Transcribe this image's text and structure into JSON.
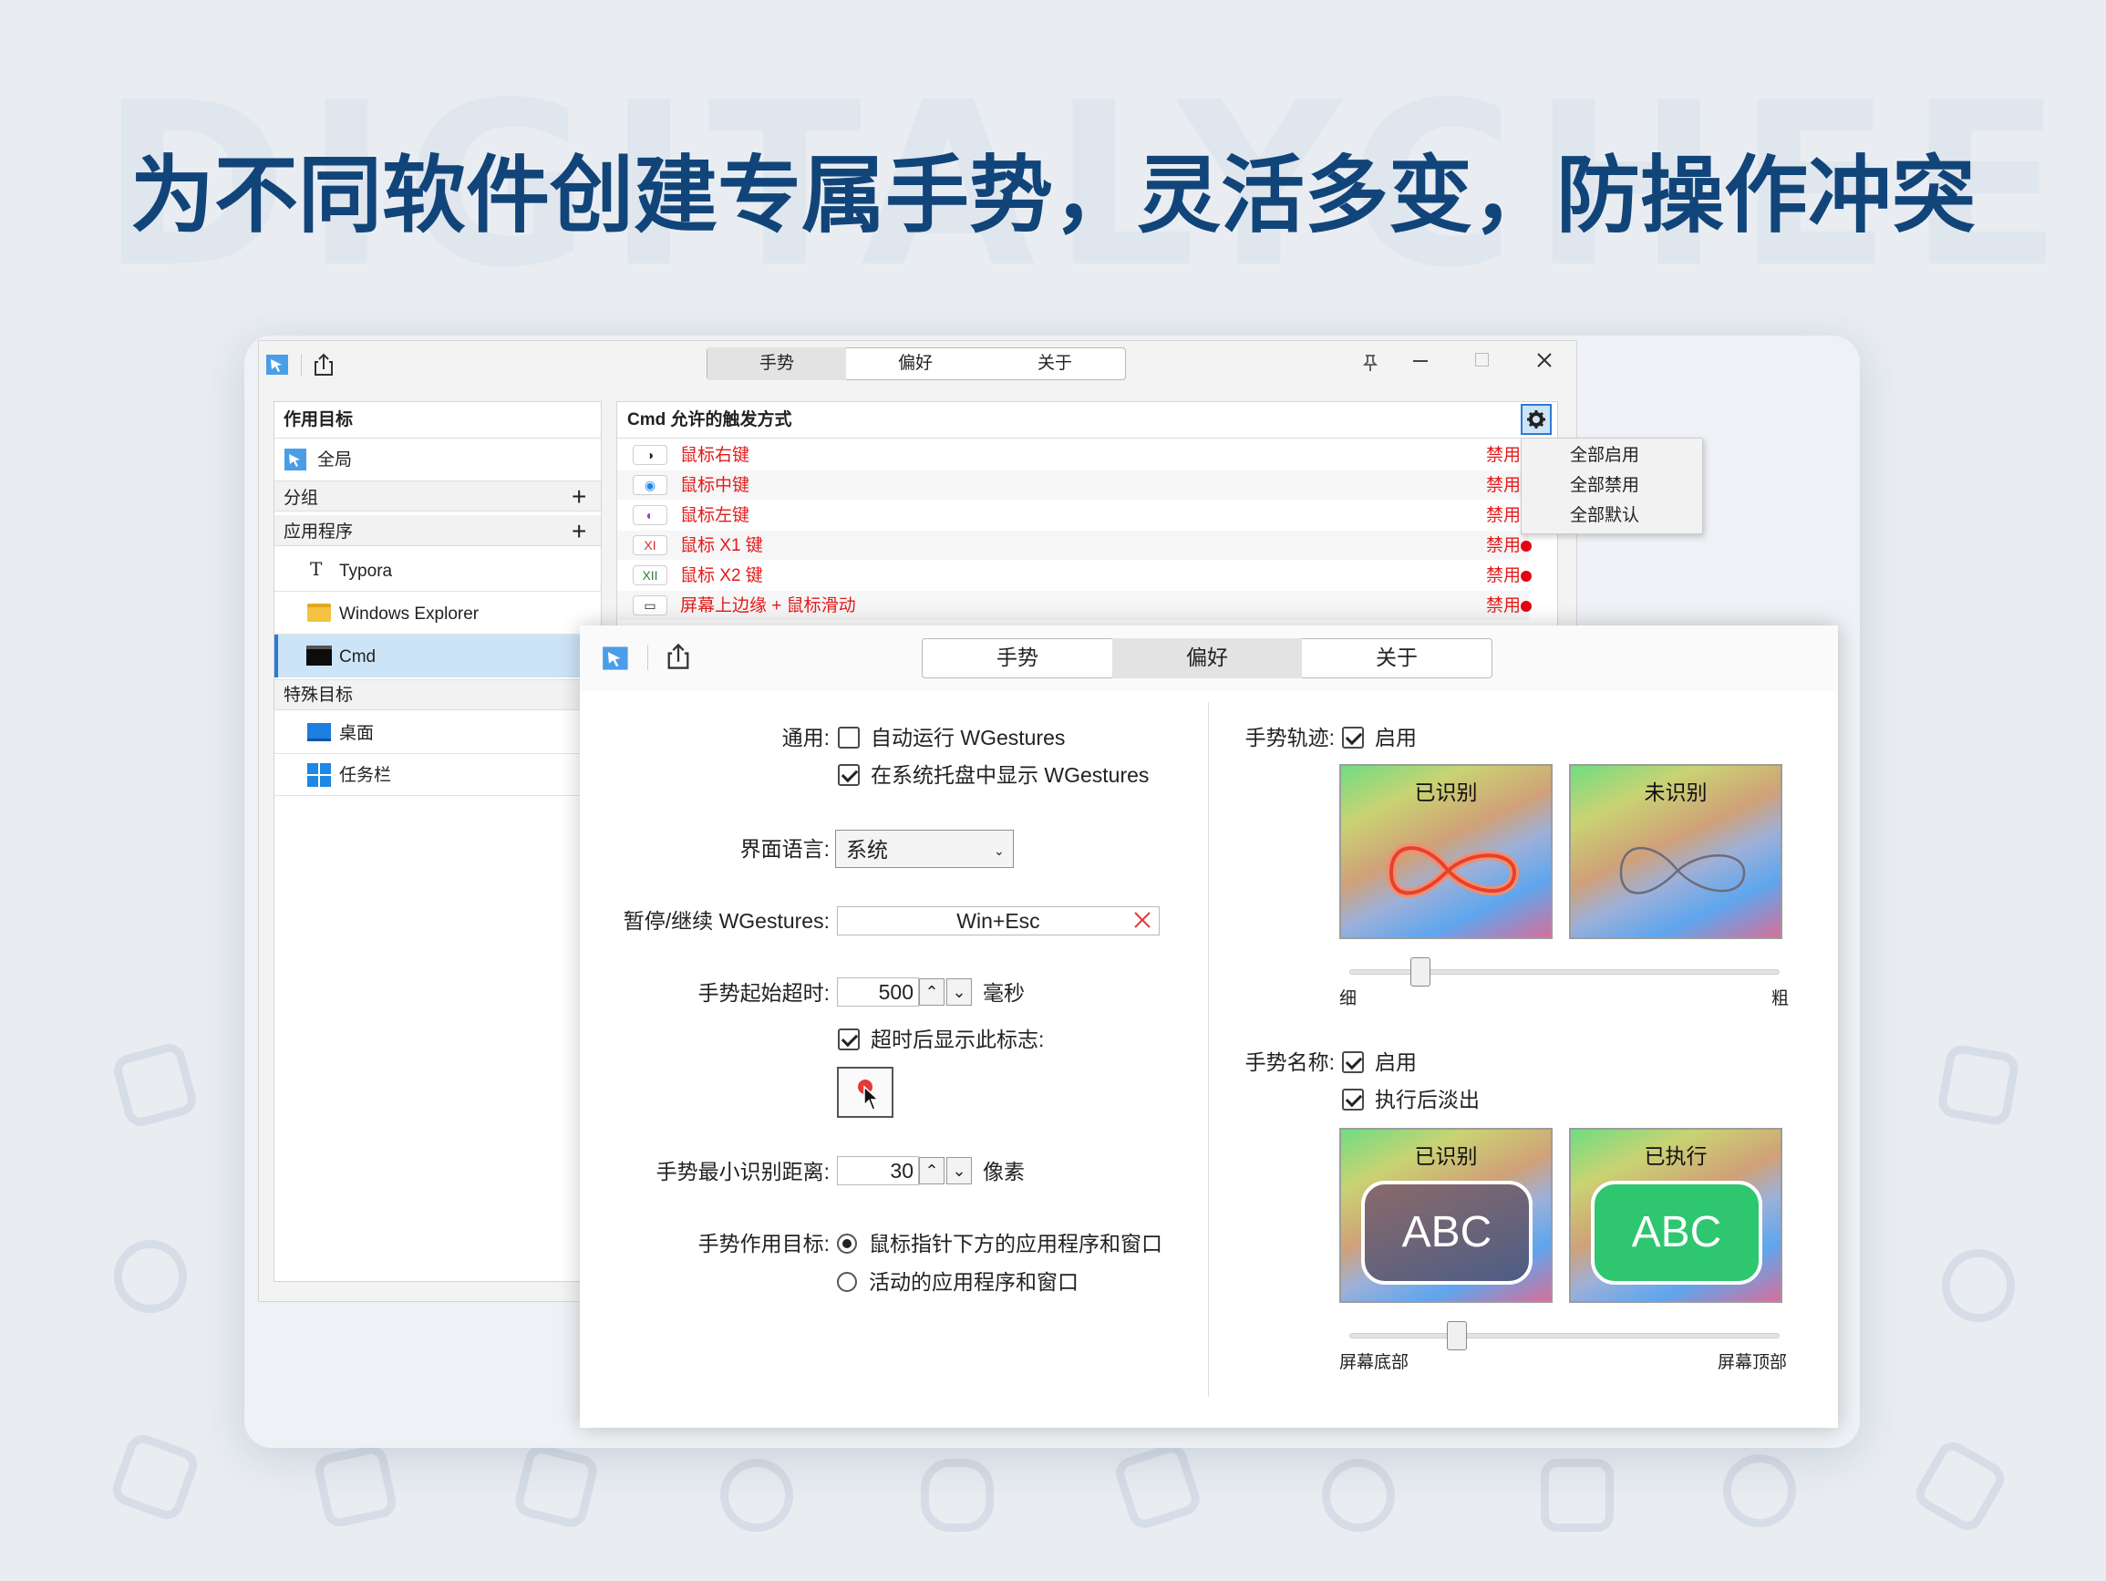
{
  "watermark": "DIGITALYCHEE",
  "headline": "为不同软件创建专属手势，灵活多变，防操作冲突",
  "back_window": {
    "tabs": [
      "手势",
      "偏好",
      "关于"
    ],
    "left_panel": {
      "targets_header": "作用目标",
      "global": "全局",
      "groups": "分组",
      "apps": "应用程序",
      "plus": "+",
      "app_items": [
        "Typora",
        "Windows Explorer",
        "Cmd"
      ],
      "special_header": "特殊目标",
      "special_items": [
        "桌面",
        "任务栏"
      ]
    },
    "right_panel": {
      "title": "Cmd 允许的触发方式",
      "rows": [
        {
          "icon": "◑",
          "label": "鼠标右键",
          "status": "禁用",
          "dot": false
        },
        {
          "icon": "◉",
          "label": "鼠标中键",
          "status": "禁用",
          "dot": false
        },
        {
          "icon": "◐",
          "label": "鼠标左键",
          "status": "禁用",
          "dot": false
        },
        {
          "icon": "XI",
          "label": "鼠标 X1 键",
          "status": "禁用",
          "dot": true
        },
        {
          "icon": "XII",
          "label": "鼠标 X2 键",
          "status": "禁用",
          "dot": true
        },
        {
          "icon": "▭",
          "label": "屏幕上边缘 + 鼠标滑动",
          "status": "禁用",
          "dot": true
        }
      ],
      "menu": [
        "全部启用",
        "全部禁用",
        "全部默认"
      ]
    }
  },
  "front_window": {
    "tabs": [
      "手势",
      "偏好",
      "关于"
    ],
    "active_tab": "偏好",
    "general_label": "通用:",
    "autorun": "自动运行 WGestures",
    "tray": "在系统托盘中显示 WGestures",
    "language_label": "界面语言:",
    "language_value": "系统",
    "pause_label": "暂停/继续 WGestures:",
    "pause_hotkey": "Win+Esc",
    "timeout_label": "手势起始超时:",
    "timeout_value": "500",
    "timeout_unit": "毫秒",
    "timeout_show": "超时后显示此标志:",
    "min_dist_label": "手势最小识别距离:",
    "min_dist_value": "30",
    "min_dist_unit": "像素",
    "target_label": "手势作用目标:",
    "target_opt1": "鼠标指针下方的应用程序和窗口",
    "target_opt2": "活动的应用程序和窗口",
    "trail_label": "手势轨迹:",
    "enable": "启用",
    "recognized": "已识别",
    "unrecognized": "未识别",
    "thin": "细",
    "thick": "粗",
    "thickness_level": 0.17,
    "name_label": "手势名称:",
    "fade": "执行后淡出",
    "executed": "已执行",
    "abc": "ABC",
    "bottom": "屏幕底部",
    "top": "屏幕顶部",
    "position_level": 0.24
  },
  "colors": {
    "headline": "#11457a",
    "red": "#e21b1b",
    "selected": "#cce4f7"
  }
}
